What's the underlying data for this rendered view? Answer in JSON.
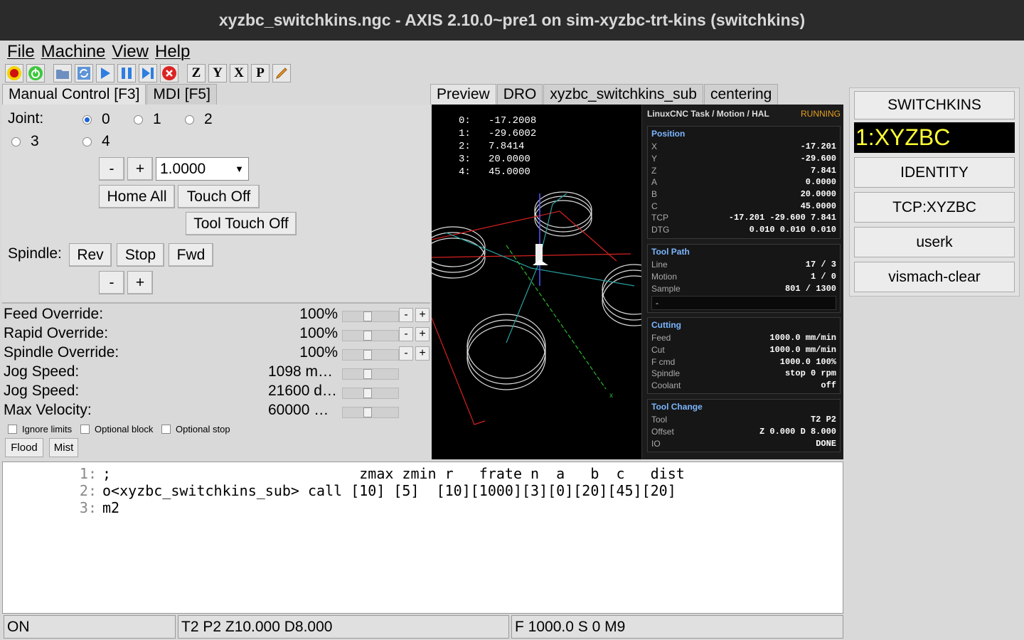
{
  "window": {
    "title": "xyzbc_switchkins.ngc - AXIS 2.10.0~pre1 on sim-xyzbc-trt-kins (switchkins)"
  },
  "menu": [
    "File",
    "Machine",
    "View",
    "Help"
  ],
  "toolbar": {
    "letters": [
      "Z",
      "Y",
      "X",
      "P"
    ]
  },
  "left_tabs": [
    "Manual Control [F3]",
    "MDI [F5]"
  ],
  "manual": {
    "joint_label": "Joint:",
    "joints": [
      "0",
      "1",
      "2",
      "3",
      "4"
    ],
    "selected_joint": "0",
    "minus": "-",
    "plus": "+",
    "increment": "1.0000",
    "home_all": "Home All",
    "touch_off": "Touch Off",
    "tool_touch_off": "Tool Touch Off",
    "spindle_label": "Spindle:",
    "rev": "Rev",
    "stop": "Stop",
    "fwd": "Fwd"
  },
  "overrides": [
    {
      "name": "Feed Override:",
      "value": "100%"
    },
    {
      "name": "Rapid Override:",
      "value": "100%"
    },
    {
      "name": "Spindle Override:",
      "value": "100%"
    },
    {
      "name": "Jog Speed:",
      "value": "1098 m…"
    },
    {
      "name": "Jog Speed:",
      "value": "21600 d…"
    },
    {
      "name": "Max Velocity:",
      "value": "60000 …"
    }
  ],
  "checks": [
    "Ignore limits",
    "Optional block",
    "Optional stop"
  ],
  "coolant": {
    "flood": "Flood",
    "mist": "Mist"
  },
  "center_tabs": [
    "Preview",
    "DRO",
    "xyzbc_switchkins_sub",
    "centering"
  ],
  "hud": [
    "0:   -17.2008",
    "1:   -29.6002",
    "2:   7.8414",
    "3:   20.0000",
    "4:   45.0000"
  ],
  "panel": {
    "title": "LinuxCNC Task / Motion / HAL",
    "state": "RUNNING",
    "position": {
      "title": "Position",
      "rows": [
        [
          "X",
          "-17.201"
        ],
        [
          "Y",
          "-29.600"
        ],
        [
          "Z",
          "7.841"
        ],
        [
          "A",
          "0.0000"
        ],
        [
          "B",
          "20.0000"
        ],
        [
          "C",
          "45.0000"
        ],
        [
          "TCP",
          "-17.201 -29.600 7.841"
        ],
        [
          "DTG",
          "0.010 0.010 0.010"
        ]
      ]
    },
    "toolpath": {
      "title": "Tool Path",
      "rows": [
        [
          "Line",
          "17 / 3"
        ],
        [
          "Motion",
          "1 / 0"
        ],
        [
          "Sample",
          "801 / 1300"
        ]
      ],
      "field": "-"
    },
    "cutting": {
      "title": "Cutting",
      "rows": [
        [
          "Feed",
          "1000.0 mm/min"
        ],
        [
          "Cut",
          "1000.0 mm/min"
        ],
        [
          "F cmd",
          "1000.0 100%"
        ],
        [
          "Spindle",
          "stop 0 rpm"
        ],
        [
          "Coolant",
          "off"
        ]
      ]
    },
    "toolchange": {
      "title": "Tool Change",
      "rows": [
        [
          "Tool",
          "T2 P2"
        ],
        [
          "Offset",
          "Z 0.000 D 8.000"
        ],
        [
          "IO",
          "DONE"
        ]
      ]
    }
  },
  "right": {
    "switchkins": "SWITCHKINS",
    "kins_display": "1:XYZBC",
    "identity": "IDENTITY",
    "tcp": "TCP:XYZBC",
    "userk": "userk",
    "vismach": "vismach-clear"
  },
  "gcode": [
    {
      "num": "1:",
      "text": ";                             zmax zmin r   frate n  a   b  c   dist"
    },
    {
      "num": "2:",
      "text": "o<xyzbc_switchkins_sub> call [10] [5]  [10][1000][3][0][20][45][20]"
    },
    {
      "num": "3:",
      "text": "m2"
    }
  ],
  "statusbar": {
    "state": "ON",
    "tool": "T2 P2 Z10.000 D8.000",
    "feed": "F 1000.0 S 0 M9"
  },
  "colors": {
    "kins_bg": "#000000",
    "kins_fg": "#ffff33",
    "running": "#e6a020",
    "panel_heading": "#7bb6ff"
  }
}
